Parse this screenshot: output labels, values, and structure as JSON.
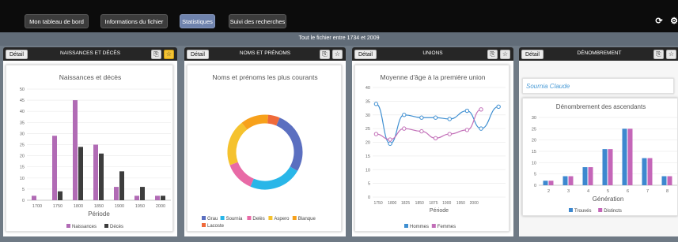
{
  "tabs": [
    {
      "label": "Mon tableau de bord",
      "active": false
    },
    {
      "label": "Informations du fichier",
      "active": false
    },
    {
      "label": "Statistiques",
      "active": true
    },
    {
      "label": "Suivi des recherches",
      "active": false
    }
  ],
  "topbar_icons": [
    "refresh-icon",
    "gear-icon"
  ],
  "subtitle": "Tout le fichier entre 1734 et 2009",
  "detail_label": "Détail",
  "panels": [
    {
      "title": "NAISSANCES ET DÉCÈS",
      "icons": [
        "export-icon",
        "star-icon-active"
      ]
    },
    {
      "title": "NOMS ET PRÉNOMS",
      "icons": [
        "export-icon",
        "star-icon"
      ]
    },
    {
      "title": "UNIONS",
      "icons": [
        "export-icon",
        "star-icon"
      ]
    },
    {
      "title": "DÉNOMBREMENT",
      "icons": [
        "export-icon",
        "star-icon"
      ]
    }
  ],
  "person_name": "Sournia Claude",
  "colors": {
    "accent_tab": "#6f83ad",
    "star_active": "#f3c233"
  },
  "chart_data": [
    {
      "type": "bar",
      "title": "Naissances et décès",
      "xlabel": "Période",
      "ylabel": "",
      "categories": [
        "1700",
        "1750",
        "1800",
        "1850",
        "1900",
        "1950",
        "2000"
      ],
      "ylim": [
        0,
        50
      ],
      "yticks": [
        0,
        5,
        10,
        15,
        20,
        25,
        30,
        35,
        40,
        45,
        50
      ],
      "series": [
        {
          "name": "Naissances",
          "color": "#b16bb5",
          "values": [
            2,
            29,
            45,
            25,
            6,
            2,
            2
          ]
        },
        {
          "name": "Décès",
          "color": "#3d3d3d",
          "values": [
            0,
            4,
            24,
            21,
            13,
            6,
            2
          ]
        }
      ],
      "legend": "bottom"
    },
    {
      "type": "pie",
      "title": "Noms et prénoms les plus courants",
      "labels": [
        "Grau",
        "Sournia",
        "Delès",
        "Aspero",
        "Blanque",
        "Lacoste"
      ],
      "colors": [
        "#5b6fc0",
        "#29b6e8",
        "#e86aa6",
        "#f5c22e",
        "#f7a11b",
        "#ef6a3a"
      ],
      "values": [
        27,
        23,
        13,
        20,
        12,
        5
      ],
      "legend": "bottom"
    },
    {
      "type": "line",
      "title": "Moyenne d'âge à la première union",
      "xlabel": "Période",
      "ylabel": "",
      "categories": [
        "1750",
        "1800",
        "1825",
        "1850",
        "1875",
        "1900",
        "1950",
        "2000"
      ],
      "x": [
        1745,
        1765,
        1785,
        1810,
        1830,
        1850,
        1875,
        1895,
        1920
      ],
      "ylim": [
        0,
        40
      ],
      "yticks": [
        0,
        5,
        10,
        15,
        20,
        25,
        30,
        35,
        40
      ],
      "series": [
        {
          "name": "Hommes",
          "color": "#3f8fd1",
          "values": [
            34,
            19.5,
            30,
            29,
            29,
            28.5,
            31.5,
            25,
            33
          ]
        },
        {
          "name": "Femmes",
          "color": "#c26fb8",
          "values": [
            23,
            21,
            25,
            24,
            21.5,
            23,
            24.5,
            32,
            null
          ]
        }
      ],
      "legend": "bottom"
    },
    {
      "type": "bar",
      "title": "Dénombrement des ascendants",
      "xlabel": "Génération",
      "ylabel": "",
      "categories": [
        "2",
        "3",
        "4",
        "5",
        "6",
        "7",
        "8"
      ],
      "ylim": [
        0,
        30
      ],
      "yticks": [
        0,
        5,
        10,
        15,
        20,
        25,
        30
      ],
      "series": [
        {
          "name": "Trouvés",
          "color": "#3d88cf",
          "values": [
            2,
            4,
            8,
            16,
            25,
            12,
            4
          ]
        },
        {
          "name": "Distincts",
          "color": "#c466b8",
          "values": [
            2,
            4,
            8,
            16,
            25,
            12,
            4
          ]
        }
      ],
      "legend": "bottom"
    }
  ]
}
